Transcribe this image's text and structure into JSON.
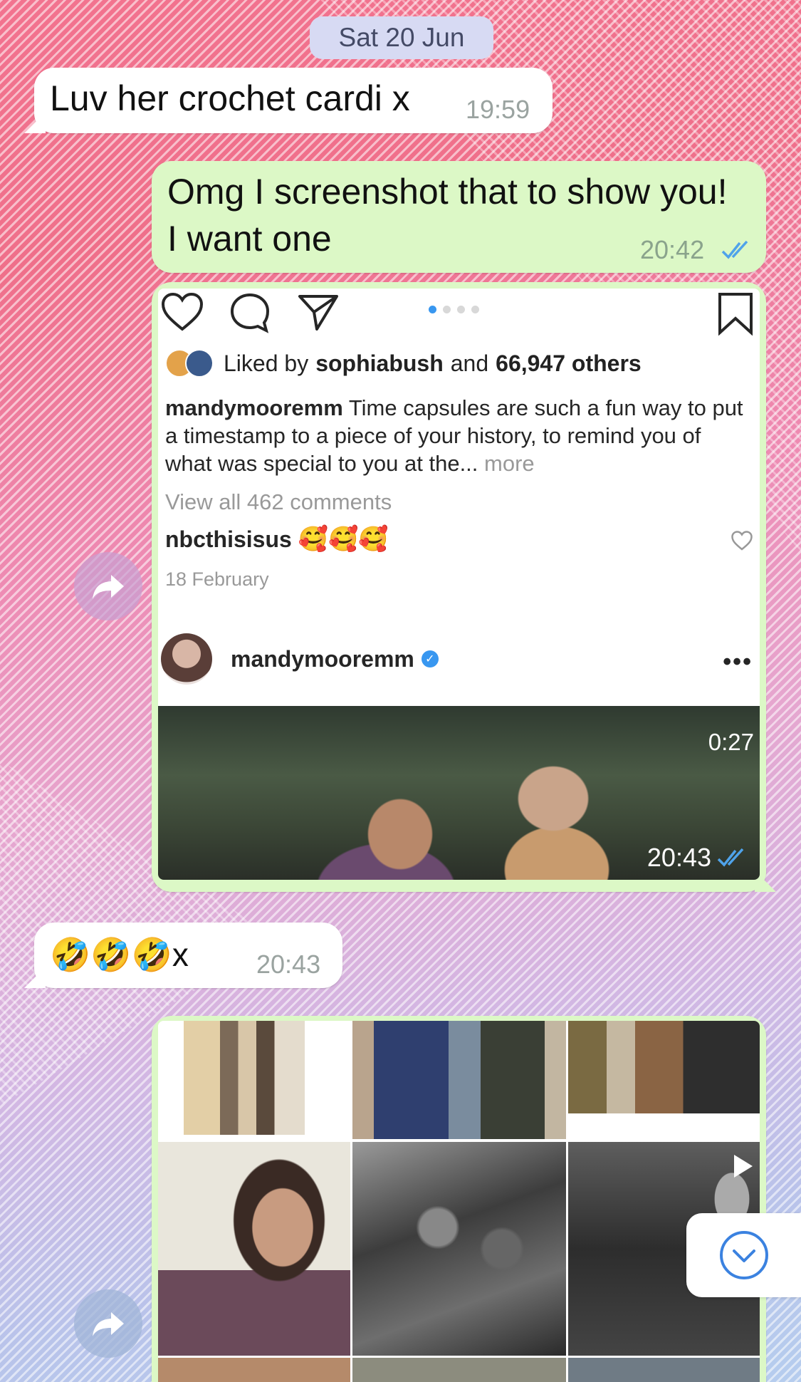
{
  "date_label": "Sat 20 Jun",
  "messages": [
    {
      "text": "Luv her crochet cardi x",
      "time": "19:59"
    },
    {
      "text_line1": "Omg I screenshot that to show you!",
      "text_line2": "I want one",
      "time": "20:42"
    },
    {
      "time": "20:43"
    },
    {
      "emoji": "🤣🤣🤣",
      "suffix": "x",
      "time": "20:43"
    }
  ],
  "instagram": {
    "liked_prefix": "Liked by",
    "liked_user": "sophiabush",
    "liked_and": "and",
    "liked_others": "66,947 others",
    "caption_user": "mandymooremm",
    "caption_text": "Time capsules are such a fun way to put a timestamp to a piece of your history, to remind you of what was special to you at the...",
    "more": "more",
    "view_all": "View all 462 comments",
    "comment_user": "nbcthisisus",
    "comment_emoji": "🥰🥰🥰",
    "date": "18 February",
    "post_user": "mandymooremm",
    "video_duration": "0:27"
  },
  "colors": {
    "outgoing_bubble": "#dcf8c6",
    "incoming_bubble": "#ffffff",
    "read_ticks": "#4fa3ea",
    "ig_blue": "#3897f0"
  }
}
